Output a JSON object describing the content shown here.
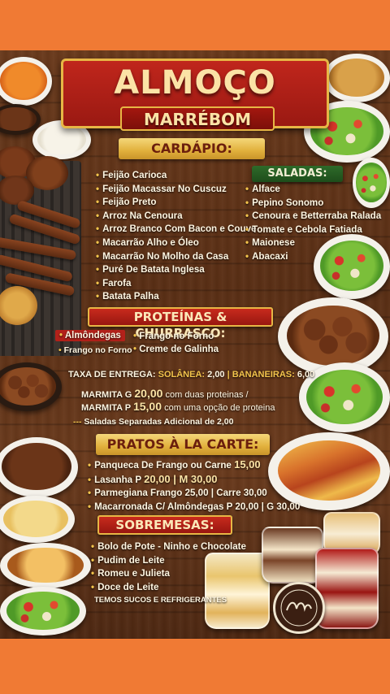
{
  "header": {
    "title": "ALMOÇO",
    "subtitle": "MARRÉBOM"
  },
  "cardapio": {
    "heading": "CARDÁPIO:",
    "items": [
      "Feijão Carioca",
      "Feijão Macassar No Cuscuz",
      "Feijão Preto",
      "Arroz Na Cenoura",
      "Arroz Branco Com Bacon e Couve",
      "Macarrão Alho e Óleo",
      "Macarrão No Molho da Casa",
      "Puré De Batata Inglesa",
      "Farofa",
      "Batata Palha"
    ]
  },
  "saladas": {
    "heading": "SALADAS:",
    "items": [
      "Alface",
      "Pepino Sonomo",
      "Cenoura e Betterraba Ralada",
      "Tomate e Cebola Fatiada",
      "Maionese",
      "Abacaxi"
    ]
  },
  "proteinas": {
    "heading": "PROTEÍNAS & CHURRASCO:",
    "items": [
      "Almôndegas",
      "Frango no Forno",
      "Frango no Forno",
      "Creme de Galinha"
    ]
  },
  "taxa": {
    "label": "TAXA DE ENTREGA:",
    "place1": "SOLÂNEA:",
    "value1": "2,00",
    "place2": "BANANEIRAS:",
    "value2": "6,00"
  },
  "marmitas": {
    "g_label": "MARMITA G",
    "g_price": "20,00",
    "g_desc": "com duas proteinas /",
    "p_label": "MARMITA P",
    "p_price": "15,00",
    "p_desc": "com uma opção de proteina",
    "note": "Saladas Separadas Adicional de 2,00"
  },
  "carte": {
    "heading": "PRATOS À LA CARTE:",
    "items": [
      {
        "name": "Panqueca De Frango ou Carne",
        "price": "15,00"
      },
      {
        "name": "Lasanha P",
        "price": "20,00 | M 30,00"
      },
      {
        "name": "Parmegiana Frango 25,00 | Carre 30,00",
        "price": ""
      },
      {
        "name": "Macarronada C/ Almôndegas P 20,00 | G 30,00",
        "price": ""
      }
    ]
  },
  "sobremesas": {
    "heading": "SOBREMESAS:",
    "items": [
      "Bolo de Pote - Ninho e Chocolate",
      "Pudim de Leite",
      "Romeu e Julieta",
      "Doce de Leite"
    ],
    "footer": "TEMOS SUCOS E REFRIGERANTES"
  },
  "colors": {
    "background": "#f07a34",
    "wood": "#5a2f15",
    "red": "#b3211a",
    "gold": "#e1b03c",
    "green": "#2e6b2a"
  }
}
